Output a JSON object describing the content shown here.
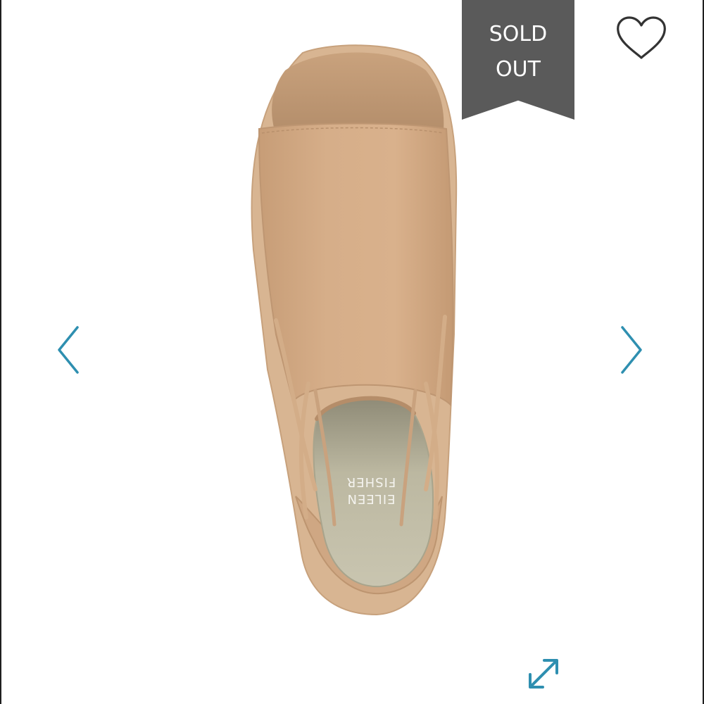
{
  "product": {
    "brand_print": "EILEEN FISHER",
    "brand_print_line1": "EILEEN",
    "brand_print_line2": "FISHER",
    "image_alt": "Eileen Fisher open-toe suede bootie, top view"
  },
  "badge": {
    "line1": "SOLD",
    "line2": "OUT",
    "background_color": "#5a5a5a",
    "text_color": "#ffffff"
  },
  "icons": {
    "favorite": "heart-outline-icon",
    "previous": "chevron-left-icon",
    "next": "chevron-right-icon",
    "zoom": "expand-arrows-icon"
  },
  "colors": {
    "accent": "#2e8fb0",
    "background": "#ffffff",
    "heart_stroke": "#333333",
    "shoe_suede": "#d2aa85",
    "shoe_lining": "#b9b49c"
  }
}
